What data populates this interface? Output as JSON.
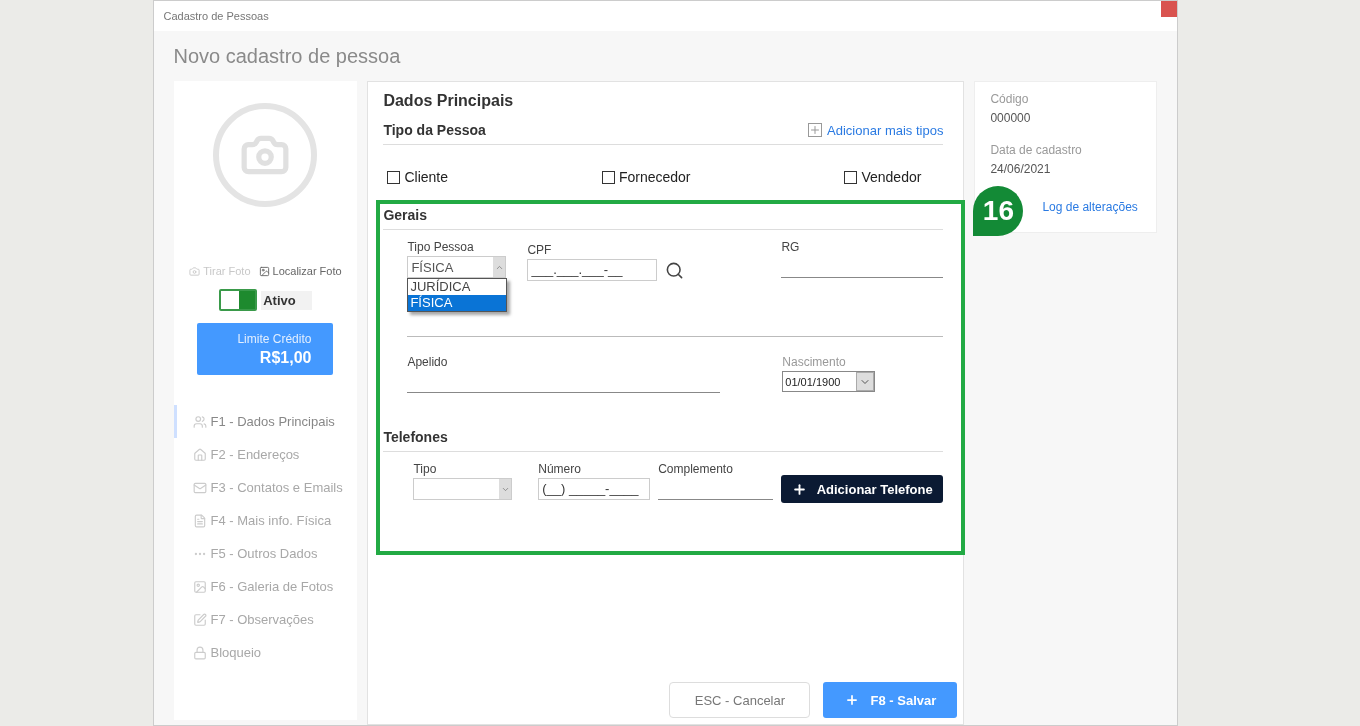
{
  "window": {
    "title": "Cadastro de Pessoas"
  },
  "header": {
    "title": "Novo cadastro de pessoa"
  },
  "profile": {
    "photo_actions": [
      "Tirar Foto",
      "Localizar Foto"
    ],
    "status": {
      "label": "Ativo",
      "on": true
    },
    "credit": {
      "label": "Limite Crédito",
      "value": "R$1,00"
    }
  },
  "nav": [
    {
      "label": "F1 - Dados Principais",
      "selected": true
    },
    {
      "label": "F2 - Endereços",
      "selected": false
    },
    {
      "label": "F3 - Contatos e Emails",
      "selected": false
    },
    {
      "label": "F4 - Mais info. Física",
      "selected": false
    },
    {
      "label": "F5 - Outros Dados",
      "selected": false
    },
    {
      "label": "F6 - Galeria de Fotos",
      "selected": false
    },
    {
      "label": "F7 - Observações",
      "selected": false
    },
    {
      "label": "Bloqueio",
      "selected": false
    }
  ],
  "main": {
    "title": "Dados Principais",
    "person_type": {
      "title": "Tipo da Pessoa",
      "add_link": "Adicionar mais tipos",
      "options": [
        {
          "label": "Cliente",
          "checked": false
        },
        {
          "label": "Fornecedor",
          "checked": false
        },
        {
          "label": "Vendedor",
          "checked": false
        }
      ]
    },
    "general": {
      "title": "Gerais",
      "tipo_pessoa": {
        "label": "Tipo Pessoa",
        "value": "FÍSICA",
        "expanded": true,
        "options": [
          {
            "label": "JURÍDICA",
            "selected": false
          },
          {
            "label": "FÍSICA",
            "selected": true
          }
        ]
      },
      "cpf": {
        "label": "CPF",
        "value": "___.___.___-__"
      },
      "rg": {
        "label": "RG"
      },
      "apelido": {
        "label": "Apelido"
      },
      "nascimento": {
        "label": "Nascimento",
        "value": "01/01/1900"
      }
    },
    "phones": {
      "title": "Telefones",
      "tipo": {
        "label": "Tipo"
      },
      "numero": {
        "label": "Número",
        "value": "(__) _____-____"
      },
      "complemento": {
        "label": "Complemento"
      },
      "add_button": "Adicionar Telefone"
    }
  },
  "info": {
    "fields": [
      {
        "label": "Código",
        "value": "000000"
      },
      {
        "label": "Data de cadastro",
        "value": "24/06/2021"
      }
    ],
    "log_link": "Log de alterações"
  },
  "footer": {
    "cancel": "ESC - Cancelar",
    "save": "F8 - Salvar"
  },
  "annotation": {
    "number": "16"
  }
}
